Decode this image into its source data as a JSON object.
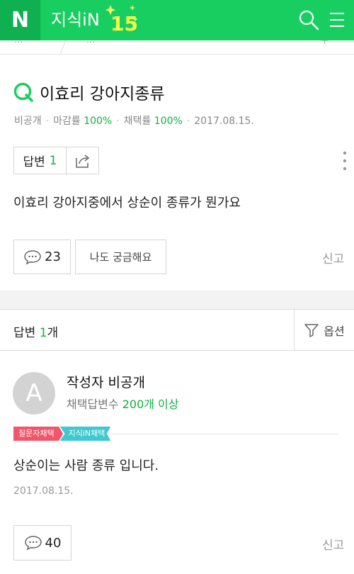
{
  "header": {
    "logo_letter": "N",
    "brand_name": "지식iN",
    "brand_badge": "15"
  },
  "subnav": {
    "crumb1": "...",
    "crumb2": "..."
  },
  "question": {
    "title": "이효리 강아지종류",
    "visibility": "비공개",
    "close_label": "마감률",
    "close_rate": "100%",
    "adopt_label": "채택률",
    "adopt_rate": "100%",
    "date": "2017.08.15.",
    "answer_label": "답변",
    "answer_count": "1",
    "body": "이효리 강아지중에서 상순이 종류가 뭔가요",
    "comment_count": "23",
    "curious_label": "나도 궁금해요",
    "report_label": "신고"
  },
  "answers_header": {
    "label": "답변",
    "count": "1",
    "suffix": "개",
    "options_label": "옵션"
  },
  "answer": {
    "avatar_letter": "A",
    "writer_name": "작성자 비공개",
    "stat_label": "채택답변수",
    "stat_value": "200개 이상",
    "tag_asker": "질문자채택",
    "tag_jisik": "지식iN채택",
    "body": "상순이는 사람 종류 입니다.",
    "date": "2017.08.15.",
    "comment_count": "40",
    "report_label": "신고"
  },
  "colors": {
    "brand_green": "#19ce60",
    "accent_green": "#12b03f",
    "tag_red": "#f0556a",
    "tag_teal": "#3ec8cf"
  }
}
